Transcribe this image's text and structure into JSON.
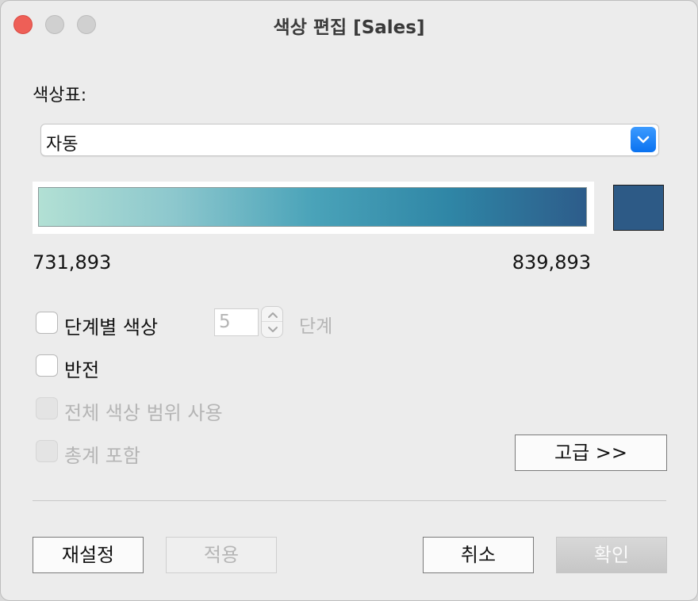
{
  "window": {
    "title": "색상 편집 [Sales]"
  },
  "palette": {
    "label": "색상표:",
    "selected": "자동",
    "gradient_colors": [
      "#b2e0d4",
      "#8cc7cd",
      "#4aa3b9",
      "#2f86a6",
      "#2d5c8a"
    ],
    "end_color": "#2d5a86"
  },
  "range": {
    "min": "731,893",
    "max": "839,893"
  },
  "options": {
    "stepped": {
      "label": "단계별 색상",
      "checked": false,
      "enabled": true
    },
    "steps": {
      "value": "5",
      "unit": "단계",
      "enabled": false
    },
    "reversed": {
      "label": "반전",
      "checked": false,
      "enabled": true
    },
    "full_range": {
      "label": "전체 색상 범위 사용",
      "checked": false,
      "enabled": false
    },
    "include_totals": {
      "label": "총계 포함",
      "checked": false,
      "enabled": false
    }
  },
  "buttons": {
    "advanced": "고급 >>",
    "reset": "재설정",
    "apply": "적용",
    "cancel": "취소",
    "ok": "확인"
  }
}
